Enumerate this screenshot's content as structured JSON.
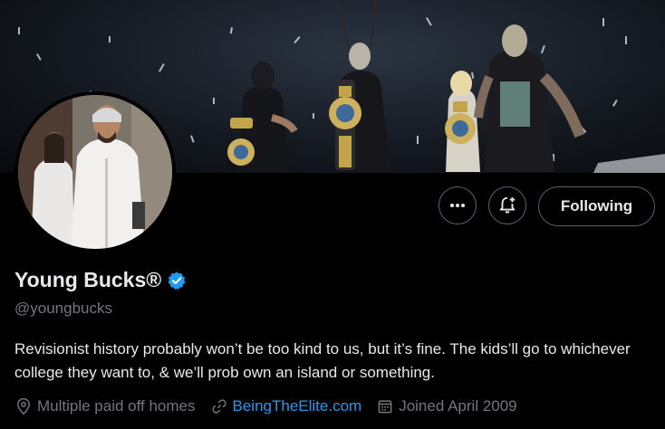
{
  "profile": {
    "name": "Young Bucks®",
    "handle": "@youngbucks",
    "bio": "Revisionist history probably won’t be too kind to us, but it’s fine. The kids’ll go to whichever college they want to, & we’ll prob own an island or something.",
    "location": "Multiple paid off homes",
    "website": "BeingTheElite.com",
    "joined": "Joined April 2009"
  },
  "actions": {
    "more_label": "•••",
    "following_label": "Following"
  },
  "icons": {
    "more": "more-icon",
    "notify": "bell-plus-icon",
    "verified": "verified-badge-icon",
    "location": "location-pin-icon",
    "link": "link-icon",
    "calendar": "calendar-icon"
  },
  "colors": {
    "background": "#000000",
    "text": "#e7e9ea",
    "secondary": "#71767b",
    "accent": "#1d9bf0",
    "border": "#536471"
  }
}
